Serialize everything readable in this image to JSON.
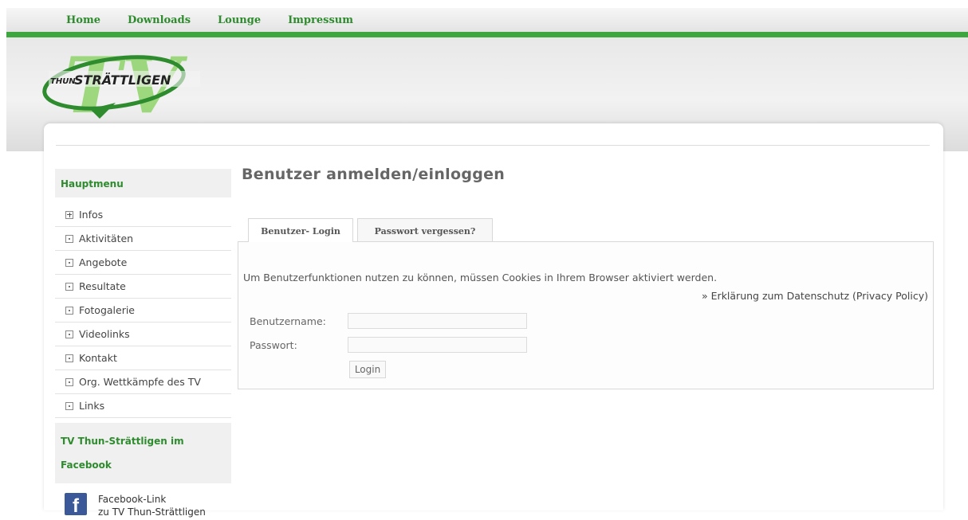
{
  "nav": {
    "items": [
      {
        "label": "Home"
      },
      {
        "label": "Downloads"
      },
      {
        "label": "Lounge"
      },
      {
        "label": "Impressum"
      }
    ]
  },
  "brand": {
    "logo_text_a": "THUN",
    "logo_text_b": "STRÄTTLIGEN",
    "logo_letters": "TV",
    "accent_color": "#3ea63e"
  },
  "sidebar": {
    "main_menu_title": "Hauptmenu",
    "items": [
      {
        "label": "Infos",
        "icon": "plus-box-icon"
      },
      {
        "label": "Aktivitäten",
        "icon": "dot-box-icon"
      },
      {
        "label": "Angebote",
        "icon": "dot-box-icon"
      },
      {
        "label": "Resultate",
        "icon": "dot-box-icon"
      },
      {
        "label": "Fotogalerie",
        "icon": "dot-box-icon"
      },
      {
        "label": "Videolinks",
        "icon": "dot-box-icon"
      },
      {
        "label": "Kontakt",
        "icon": "dot-box-icon"
      },
      {
        "label": "Org. Wettkämpfe des TV",
        "icon": "dot-box-icon"
      },
      {
        "label": "Links",
        "icon": "dot-box-icon"
      }
    ],
    "facebook_title": "TV Thun-Strättligen im Facebook",
    "facebook_link_line1": "Facebook-Link",
    "facebook_link_line2": "zu TV Thun-Strättligen",
    "facebook_icon_glyph": "f"
  },
  "main": {
    "title": "Benutzer anmelden/einloggen",
    "tabs": [
      {
        "label": "Benutzer- Login",
        "active": true
      },
      {
        "label": "Passwort vergessen?",
        "active": false
      }
    ],
    "notice": "Um Benutzerfunktionen nutzen zu können, müssen Cookies in Ihrem Browser aktiviert werden.",
    "privacy_link": "» Erklärung zum Datenschutz (Privacy Policy)",
    "form": {
      "username_label": "Benutzername:",
      "username_value": "",
      "password_label": "Passwort:",
      "password_value": "",
      "login_button": "Login"
    }
  }
}
